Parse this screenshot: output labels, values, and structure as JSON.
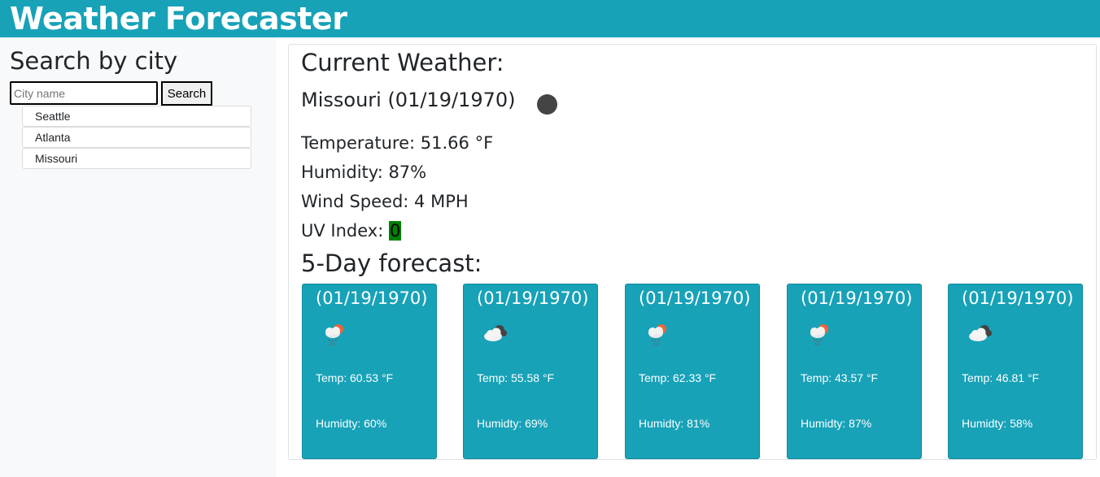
{
  "header": {
    "title": "Weather Forecaster"
  },
  "sidebar": {
    "heading": "Search by city",
    "search": {
      "placeholder": "City name",
      "value": "",
      "button_label": "Search"
    },
    "history": [
      "Seattle",
      "Atlanta",
      "Missouri"
    ]
  },
  "current": {
    "heading": "Current Weather:",
    "city_date": "Missouri (01/19/1970)",
    "icon": "dark-circle-icon",
    "temperature": "Temperature: 51.66 °F",
    "humidity": "Humidity: 87%",
    "wind": "Wind Speed: 4 MPH",
    "uv_label": "UV Index: ",
    "uv_value": "0",
    "uv_color": "#008000"
  },
  "forecast": {
    "heading": "5-Day forecast:",
    "days": [
      {
        "date": "(01/19/1970)",
        "icon": "rain-sun-cloud-icon",
        "temp": "Temp: 60.53 °F",
        "humidity": "Humidty: 60%"
      },
      {
        "date": "(01/19/1970)",
        "icon": "cloudy-icon",
        "temp": "Temp: 55.58 °F",
        "humidity": "Humidty: 69%"
      },
      {
        "date": "(01/19/1970)",
        "icon": "rain-sun-cloud-icon",
        "temp": "Temp: 62.33 °F",
        "humidity": "Humidty: 81%"
      },
      {
        "date": "(01/19/1970)",
        "icon": "rain-sun-cloud-icon",
        "temp": "Temp: 43.57 °F",
        "humidity": "Humidty: 87%"
      },
      {
        "date": "(01/19/1970)",
        "icon": "cloudy-icon",
        "temp": "Temp: 46.81 °F",
        "humidity": "Humidty: 58%"
      }
    ]
  },
  "colors": {
    "accent": "#17a2b8",
    "sidebar_bg": "#f8f9fa"
  }
}
